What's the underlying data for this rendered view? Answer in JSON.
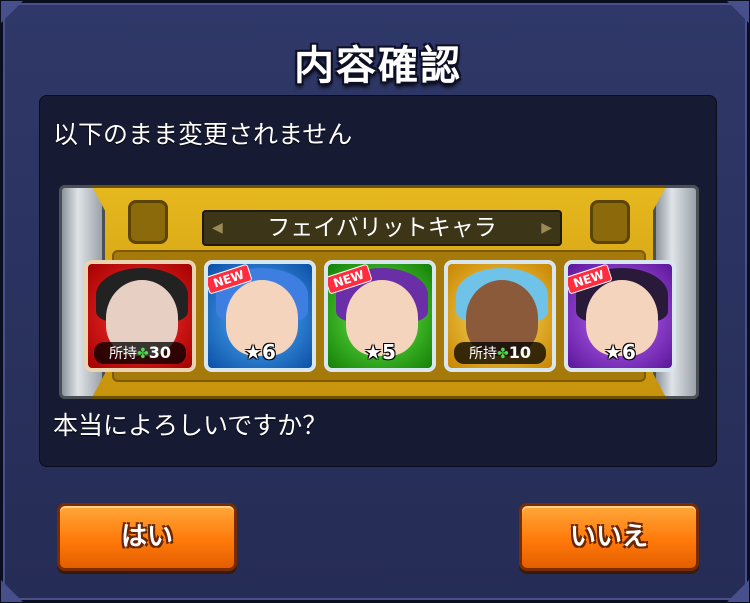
{
  "dialog": {
    "title": "内容確認",
    "message": "以下のまま変更されません",
    "question": "本当によろしいですか？"
  },
  "favorite": {
    "tab_label": "フェイバリットキャラ",
    "arrow_left": "◀",
    "arrow_right": "▶",
    "cards": [
      {
        "element": "fire",
        "color": "#d01010",
        "new": false,
        "owned_label": "所持",
        "owned_count": "30",
        "stars": ""
      },
      {
        "element": "water",
        "color": "#1a6fd6",
        "new": true,
        "new_label": "NEW",
        "owned_label": "",
        "owned_count": "",
        "stars": "★6"
      },
      {
        "element": "wood",
        "color": "#29b21a",
        "new": true,
        "new_label": "NEW",
        "owned_label": "",
        "owned_count": "",
        "stars": "★5"
      },
      {
        "element": "light",
        "color": "#e0a500",
        "new": false,
        "owned_label": "所持",
        "owned_count": "10",
        "stars": ""
      },
      {
        "element": "dark",
        "color": "#8a2fd1",
        "new": true,
        "new_label": "NEW",
        "owned_label": "",
        "owned_count": "",
        "stars": "★6"
      }
    ],
    "clover_icon": "✤"
  },
  "buttons": {
    "yes": "はい",
    "no": "いいえ"
  }
}
